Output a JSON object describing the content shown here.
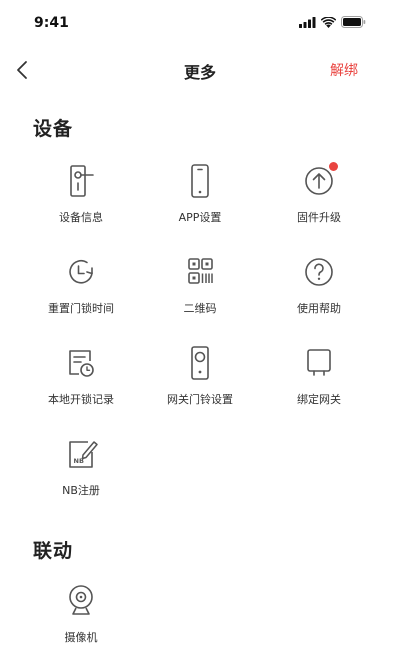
{
  "status_bar": {
    "time": "9:41"
  },
  "nav": {
    "title": "更多",
    "unbind_label": "解绑"
  },
  "colors": {
    "accent": "#e94440",
    "icon_stroke": "#555555"
  },
  "sections": {
    "device": {
      "title": "设备",
      "items": [
        {
          "label": "设备信息",
          "icon": "device-info-icon"
        },
        {
          "label": "APP设置",
          "icon": "app-settings-icon"
        },
        {
          "label": "固件升级",
          "icon": "firmware-upgrade-icon",
          "badge": true
        },
        {
          "label": "重置门锁时间",
          "icon": "reset-lock-time-icon"
        },
        {
          "label": "二维码",
          "icon": "qr-code-icon"
        },
        {
          "label": "使用帮助",
          "icon": "help-icon"
        },
        {
          "label": "本地开锁记录",
          "icon": "unlock-record-icon"
        },
        {
          "label": "网关门铃设置",
          "icon": "gateway-doorbell-icon"
        },
        {
          "label": "绑定网关",
          "icon": "bind-gateway-icon"
        },
        {
          "label": "NB注册",
          "icon": "nb-register-icon"
        }
      ]
    },
    "linkage": {
      "title": "联动",
      "items": [
        {
          "label": "摄像机",
          "icon": "camera-icon"
        }
      ]
    }
  }
}
